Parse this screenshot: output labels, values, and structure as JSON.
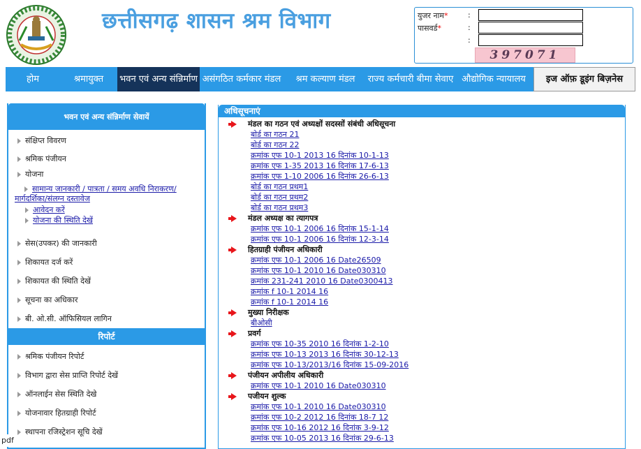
{
  "header": {
    "title": "छत्तीसगढ़ शासन श्रम विभाग",
    "login": {
      "username_label": "युजर नाम",
      "password_label": "पासवर्ड",
      "required_mark": "*",
      "colon": ":",
      "captcha": "397071"
    }
  },
  "nav": {
    "items": [
      {
        "label": "होम"
      },
      {
        "label": "श्रमायुक्त"
      },
      {
        "label": "भवन एवं अन्य संन्निर्माण"
      },
      {
        "label": "असंगठित कर्मकार मंडल"
      },
      {
        "label": "श्रम कल्याण मंडल"
      },
      {
        "label": "राज्य कर्मचारी बीमा सेवाए"
      },
      {
        "label": "औद्योगिक न्यायालय"
      },
      {
        "label": "इज ऑफ़ डूइंग बिज़नेस"
      }
    ]
  },
  "sidebar": {
    "title": "भवन एवं अन्य संन्निर्माण सेवायें",
    "items": [
      {
        "label": "संक्षिप्त विवरण"
      },
      {
        "label": "श्रमिक पंजीयन"
      },
      {
        "label": "योजना"
      },
      {
        "label": "सेस(उपकर) की जानकारी"
      },
      {
        "label": "शिकायत दर्ज करें"
      },
      {
        "label": "शिकायत की स्थिति देखें"
      },
      {
        "label": "सूचना का अधिकार"
      },
      {
        "label": "बी. ओ.सी. ऑफिसियल लागिन"
      }
    ],
    "yojana_sub": {
      "line1": "सामान्य जानकारी / पात्रता / समय अवधि निराकरण/",
      "line2": "मार्गदर्शिका/संलग्न दस्तावेज",
      "apply": "आवेदन करें",
      "status": "योजना की स्थिति देखें"
    },
    "report_title": "रिपोर्ट",
    "reports": [
      {
        "label": "श्रमिक पंजीयन रिपोर्ट"
      },
      {
        "label": "विभाग द्वारा सेस प्राप्ति रिपोर्ट देखें"
      },
      {
        "label": "ऑनलाईन सेस स्थिति देखे"
      },
      {
        "label": "योजनावार हितग्राही रिपोर्ट"
      },
      {
        "label": "स्थापना रजिस्ट्रेशन सूचि देखें"
      }
    ]
  },
  "main": {
    "title": "अधिसूचनाएं",
    "sections": [
      {
        "title": "मंडल का गठन एवं अध्यक्षों सदस्सों संबंधी अधिसूचना",
        "links": [
          "बोर्ड का गठन  21",
          "बोर्ड का गठन  22",
          "क्रमांक एफ 10-1 2013 16 दिनांक 10-1-13",
          "क्रमांक एफ 1-35 2013 16 दिनांक 17-6-13",
          "क्रमांक एफ 1-10 2006 16 दिनांक 26-6-13",
          "बोर्ड का गठन  प्रथम1",
          "बोर्ड का गठन  प्रथम2",
          "बोर्ड का गठन  प्रथम3"
        ]
      },
      {
        "title": "मंडल अध्यक्ष का त्यागपत्र",
        "links": [
          " क्रमांक एफ 10-1 2006 16 दिनांक 15-1-14",
          "क्रमांक एफ 10-1 2006 16 दिनांक 12-3-14"
        ]
      },
      {
        "title": "हितग्राही पंजीयन अधिकारी",
        "links": [
          "क्रमांक एफ 10-1 2006 16 Date26509",
          "क्रमांक एफ 10-1 2010 16 Date030310",
          "क्रमांक 231-241 2010 16 Date0300413",
          "क्रमांक f 10-1 2014 16",
          "क्रमांक f 10-1 2014 16"
        ]
      },
      {
        "title": "मुख्या निरीक्षक",
        "links": [
          "बीओसी"
        ]
      },
      {
        "title": "प्रवर्ग",
        "links": [
          "क्रमांक एफ 10-35 2010 16 दिनांक 1-2-10",
          "क्रमांक एफ 10-13 2013 16 दिनांक 30-12-13",
          "क्रमांक एफ 10-13/2013/16 दिनांक 15-09-2016"
        ]
      },
      {
        "title": "पंजीयन अपीलीय अधिकारी",
        "links": [
          "क्रमांक एफ 10-1 2010 16 Date030310"
        ]
      },
      {
        "title": "पजीयन शुल्क",
        "links": [
          " क्रमांक एफ 10-1 2010 16 Date030310",
          "क्रमांक एफ 10-2 2012 16 दिनांक 18-7 12",
          "क्रमांक एफ 10-16 2012 16 दिनांक 3-9-12",
          "क्रमांक एफ 10-05 2013 16 दिनांक 29-6-13"
        ]
      }
    ]
  },
  "footer": {
    "pdf_label": "pdf"
  }
}
